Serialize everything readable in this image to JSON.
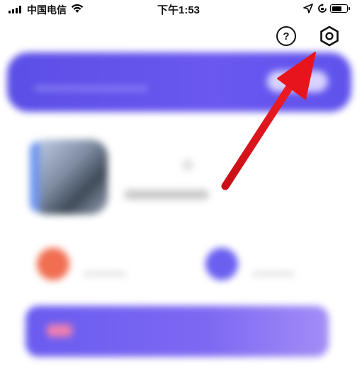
{
  "status_bar": {
    "carrier": "中国电信",
    "time": "下午1:53",
    "battery_level": 0.7
  },
  "header": {
    "help_label": "?",
    "help_icon": "question-circle-icon",
    "settings_icon": "settings-hexagon-icon"
  },
  "banner": {
    "title": "",
    "color": "#5b4ee6"
  },
  "profile": {
    "name": "",
    "avatar_color": "#6f97f0"
  },
  "stats": [
    {
      "label": "",
      "color": "#f06e52"
    },
    {
      "label": "",
      "color": "#6b5ff0"
    }
  ],
  "bottom_card": {
    "title": "",
    "action": "",
    "color": "#6a5cf0"
  },
  "annotation": {
    "type": "arrow",
    "color": "#e8141b",
    "points_to": "settings-button"
  }
}
